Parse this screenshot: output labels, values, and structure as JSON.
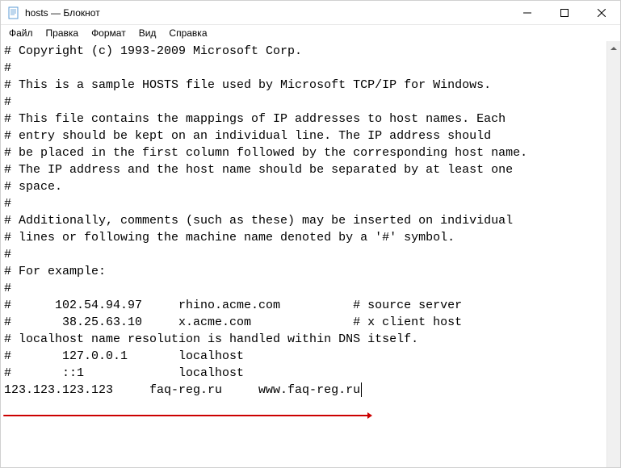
{
  "window": {
    "title": "hosts — Блокнот"
  },
  "menu": {
    "file": "Файл",
    "edit": "Правка",
    "format": "Формат",
    "view": "Вид",
    "help": "Справка"
  },
  "content": {
    "lines": [
      "# Copyright (c) 1993-2009 Microsoft Corp.",
      "#",
      "# This is a sample HOSTS file used by Microsoft TCP/IP for Windows.",
      "#",
      "# This file contains the mappings of IP addresses to host names. Each",
      "# entry should be kept on an individual line. The IP address should",
      "# be placed in the first column followed by the corresponding host name.",
      "# The IP address and the host name should be separated by at least one",
      "# space.",
      "#",
      "# Additionally, comments (such as these) may be inserted on individual",
      "# lines or following the machine name denoted by a '#' symbol.",
      "#",
      "# For example:",
      "#",
      "#      102.54.94.97     rhino.acme.com          # source server",
      "#       38.25.63.10     x.acme.com              # x client host",
      "",
      "# localhost name resolution is handled within DNS itself.",
      "#       127.0.0.1       localhost",
      "#       ::1             localhost",
      "123.123.123.123     faq-reg.ru     www.faq-reg.ru"
    ]
  },
  "annotation": {
    "underline_color": "#cc0000"
  }
}
